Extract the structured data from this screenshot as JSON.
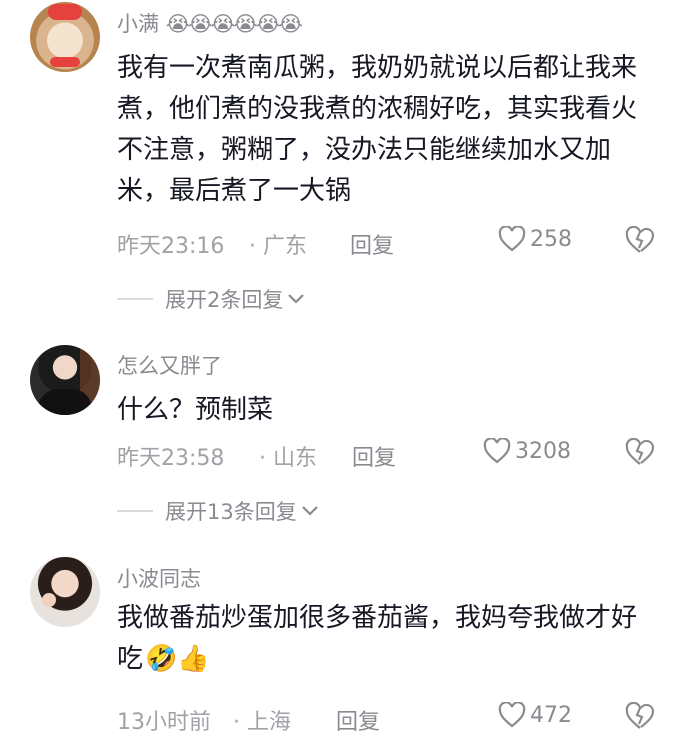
{
  "comments": [
    {
      "username": "小满",
      "username_emojis": "😭😭😭😭😭😭",
      "text": "我有一次煮南瓜粥，我奶奶就说以后都让我来煮，他们煮的没我煮的浓稠好吃，其实我看火不注意，粥糊了，没办法只能继续加水又加米，最后煮了一大锅",
      "time": "昨天23:16",
      "location": "· 广东",
      "reply": "回复",
      "likes": "258",
      "expand": "展开2条回复"
    },
    {
      "username": "怎么又胖了",
      "text": "什么？预制菜",
      "time": "昨天23:58",
      "location": "· 山东",
      "reply": "回复",
      "likes": "3208",
      "expand": "展开13条回复"
    },
    {
      "username": "小波同志",
      "text": "我做番茄炒蛋加很多番茄酱，我妈夸我做才好吃",
      "text_emojis": "🤣👍",
      "time": "13小时前",
      "location": "· 上海",
      "reply": "回复",
      "likes": "472"
    }
  ],
  "colors": {
    "text": "#161823",
    "secondary": "#8a8b91",
    "meta": "#a1a2a7"
  }
}
